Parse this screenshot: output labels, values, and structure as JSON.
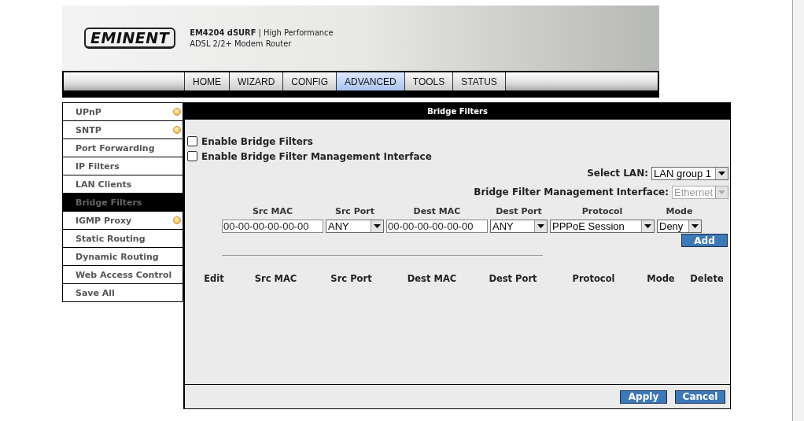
{
  "header": {
    "logo": "EMINENT",
    "model": "**EM4204 dSURF** | High Performance",
    "subtitle": "ADSL 2/2+ Modem Router"
  },
  "nav_tabs": [
    {
      "label": "HOME",
      "selected": false
    },
    {
      "label": "WIZARD",
      "selected": false
    },
    {
      "label": "CONFIG",
      "selected": false
    },
    {
      "label": "ADVANCED",
      "selected": true
    },
    {
      "label": "TOOLS",
      "selected": false
    },
    {
      "label": "STATUS",
      "selected": false
    }
  ],
  "sidebar": {
    "items": [
      {
        "label": "UPnP",
        "selected": false,
        "dot": true
      },
      {
        "label": "SNTP",
        "selected": false,
        "dot": true
      },
      {
        "label": "Port Forwarding",
        "selected": false,
        "dot": false
      },
      {
        "label": "IP Filters",
        "selected": false,
        "dot": false
      },
      {
        "label": "LAN Clients",
        "selected": false,
        "dot": false
      },
      {
        "label": "Bridge Filters",
        "selected": true,
        "dot": false
      },
      {
        "label": "IGMP Proxy",
        "selected": false,
        "dot": true
      },
      {
        "label": "Static Routing",
        "selected": false,
        "dot": false
      },
      {
        "label": "Dynamic Routing",
        "selected": false,
        "dot": false
      },
      {
        "label": "Web Access Control",
        "selected": false,
        "dot": false
      },
      {
        "label": "Save All",
        "selected": false,
        "dot": false
      }
    ]
  },
  "panel": {
    "title": "Bridge Filters",
    "checkboxes": [
      {
        "label": "Enable Bridge Filters",
        "checked": false
      },
      {
        "label": "Enable Bridge Filter Management Interface",
        "checked": false
      }
    ],
    "selects": [
      {
        "label": "Select LAN:",
        "value": "LAN group 1",
        "disabled": false
      },
      {
        "label": "Bridge Filter Management Interface:",
        "value": "Ethernet",
        "disabled": true
      }
    ],
    "filter_form": [
      {
        "heading": "Src MAC",
        "kind": "text",
        "value": "00-00-00-00-00-00"
      },
      {
        "heading": "Src Port",
        "kind": "select",
        "value": "ANY"
      },
      {
        "heading": "Dest MAC",
        "kind": "text",
        "value": "00-00-00-00-00-00"
      },
      {
        "heading": "Dest Port",
        "kind": "select",
        "value": "ANY"
      },
      {
        "heading": "Protocol",
        "kind": "select",
        "value": "PPPoE Session"
      },
      {
        "heading": "Mode",
        "kind": "select",
        "value": "Deny"
      }
    ],
    "add_button": "Add",
    "table_columns": [
      "Edit",
      "Src MAC",
      "Src Port",
      "Dest MAC",
      "Dest Port",
      "Protocol",
      "Mode",
      "Delete"
    ],
    "buttons": [
      "Apply",
      "Cancel"
    ]
  }
}
